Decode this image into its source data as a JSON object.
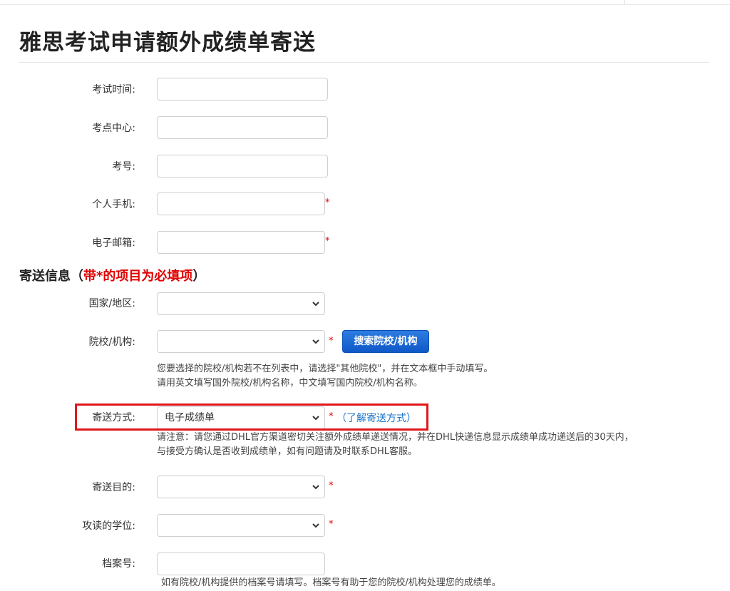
{
  "page": {
    "title": "雅思考试申请额外成绩单寄送"
  },
  "exam_info": {
    "exam_time_label": "考试时间:",
    "exam_time_value": "",
    "test_centre_label": "考点中心:",
    "test_centre_value": "",
    "candidate_no_label": "考号:",
    "candidate_no_value": "",
    "mobile_label": "个人手机:",
    "mobile_value": "",
    "email_label": "电子邮箱:",
    "email_value": ""
  },
  "required_mark": "*",
  "delivery": {
    "section_title": "寄送信息（",
    "section_note": "带*的项目为必填项",
    "section_close": "）",
    "country_label": "国家/地区:",
    "country_value": "",
    "institution_label": "院校/机构:",
    "institution_value": "",
    "search_button": "搜索院校/机构",
    "institution_hint_1": "您要选择的院校/机构若不在列表中，请选择\"其他院校\"，并在文本框中手动填写。",
    "institution_hint_2": "请用英文填写国外院校/机构名称，中文填写国内院校/机构名称。",
    "method_label": "寄送方式:",
    "method_value": "电子成绩单",
    "learn_method_link": "（了解寄送方式）",
    "method_hint_1": "请注意：请您通过DHL官方渠道密切关注额外成绩单递送情况，并在DHL快递信息显示成绩单成功递送后的30天内，",
    "method_hint_2": "与接受方确认是否收到成绩单，如有问题请及时联系DHL客服。",
    "purpose_label": "寄送目的:",
    "purpose_value": "",
    "degree_label": "攻读的学位:",
    "degree_value": "",
    "file_no_label": "档案号:",
    "file_no_value": "",
    "file_no_hint": "如有院校/机构提供的档案号请填写。档案号有助于您的院校/机构处理您的成绩单。"
  },
  "colors": {
    "required": "#e00000",
    "link": "#1a73c8",
    "button": "#1058c8",
    "highlight": "#e0161b"
  },
  "icons": {
    "dropdown": "chevron-down-icon"
  }
}
